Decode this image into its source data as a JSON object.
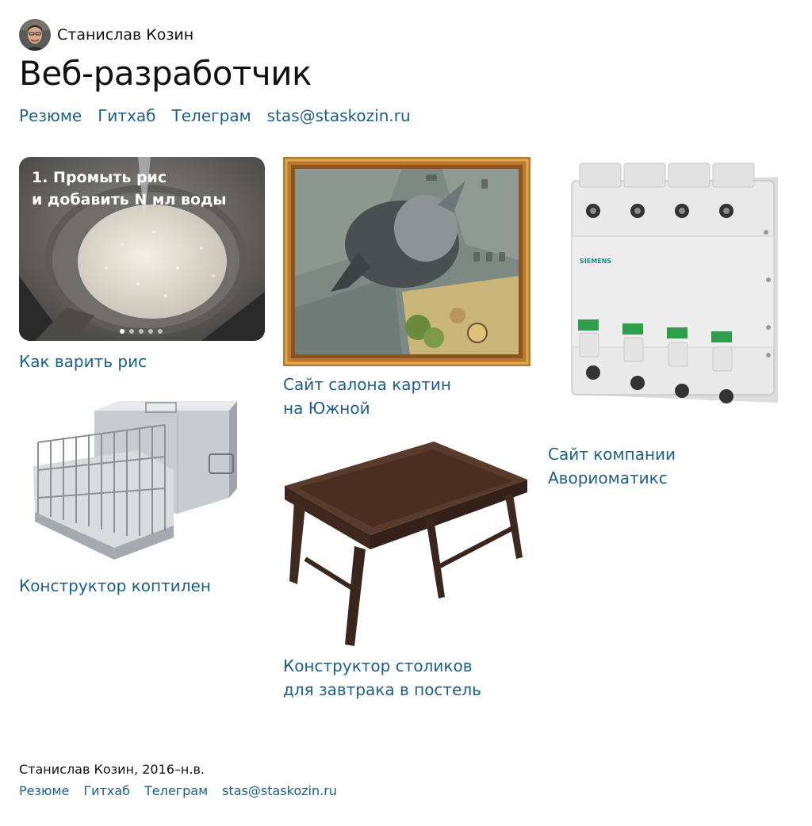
{
  "author": {
    "name": "Станислав Козин"
  },
  "headline": "Веб-разработчик",
  "nav": {
    "resume": "Резюме",
    "github": "Гитхаб",
    "telegram": "Телеграм",
    "email": "stas@staskozin.ru"
  },
  "projects": {
    "rice": {
      "title": "Как варить рис",
      "slide_text_1": "1. Промыть рис",
      "slide_text_2": "и добавить N мл воды",
      "slide_count": 5
    },
    "gallery": {
      "title_1": "Сайт салона картин",
      "title_2": "на Южной"
    },
    "switch": {
      "title_1": "Сайт компании",
      "title_2": "Авориоматикс",
      "brand": "SIEMENS"
    },
    "smoker": {
      "title": "Конструктор коптилен"
    },
    "table": {
      "title_1": "Конструктор столиков",
      "title_2": "для завтрака в постель"
    }
  },
  "footer": {
    "copyright": "Станислав Козин, 2016–н.в.",
    "nav": {
      "resume": "Резюме",
      "github": "Гитхаб",
      "telegram": "Телеграм",
      "email": "stas@staskozin.ru"
    }
  },
  "colors": {
    "link": "#1b5f86",
    "text": "#111111",
    "background": "#ffffff"
  }
}
